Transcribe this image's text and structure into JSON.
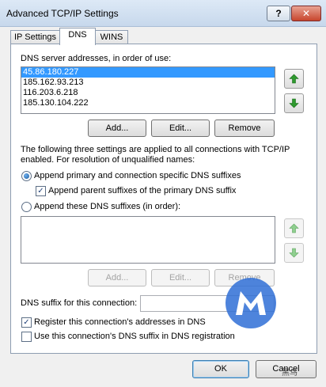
{
  "window": {
    "title": "Advanced TCP/IP Settings",
    "help_label": "?",
    "close_label": "✕"
  },
  "tabs": [
    {
      "label": "IP Settings"
    },
    {
      "label": "DNS"
    },
    {
      "label": "WINS"
    }
  ],
  "dns": {
    "servers_label": "DNS server addresses, in order of use:",
    "servers": [
      "45.86.180.227",
      "185.162.93.213",
      "116.203.6.218",
      "185.130.104.222"
    ],
    "add_label": "Add...",
    "edit_label": "Edit...",
    "remove_label": "Remove",
    "info_text_line1": "The following three settings are applied to all connections with TCP/IP",
    "info_text_line2": "enabled. For resolution of unqualified names:",
    "option_primary_label": "Append primary and connection specific DNS suffixes",
    "option_parent_label": "Append parent suffixes of the primary DNS suffix",
    "option_these_label": "Append these DNS suffixes (in order):",
    "suffix_add_label": "Add...",
    "suffix_edit_label": "Edit...",
    "suffix_remove_label": "Remove",
    "connection_suffix_label": "DNS suffix for this connection:",
    "connection_suffix_value": "",
    "register_label": "Register this connection's addresses in DNS",
    "use_suffix_label": "Use this connection's DNS suffix in DNS registration"
  },
  "footer": {
    "ok_label": "OK",
    "cancel_label": "Cancel"
  },
  "watermark_text": "黑鸟",
  "colors": {
    "selection": "#3399ff",
    "arrow_green": "#2e9a2e",
    "watermark_blue": "#2f6fd6"
  }
}
